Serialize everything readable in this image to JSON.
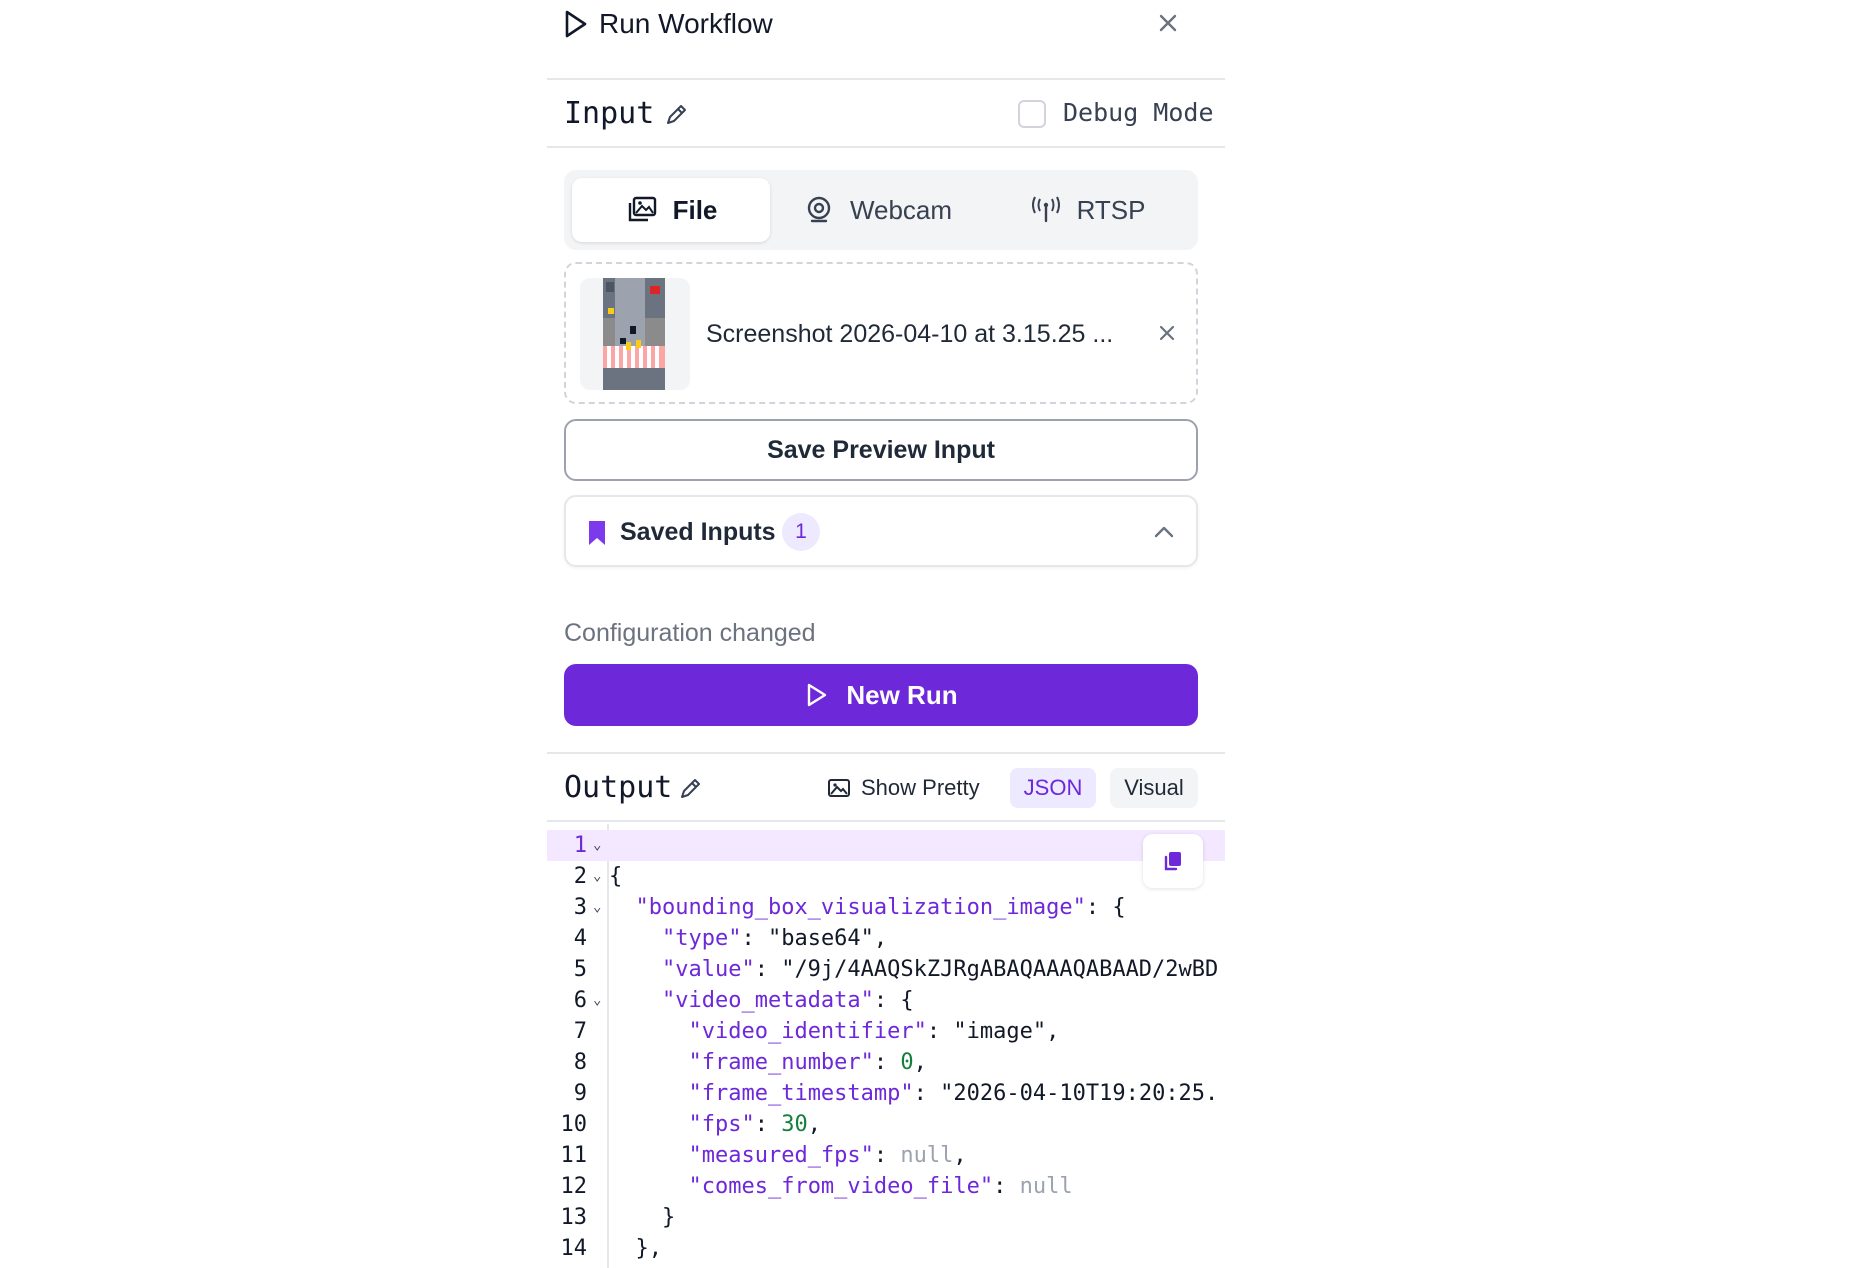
{
  "header": {
    "title": "Run Workflow"
  },
  "input": {
    "title": "Input",
    "debug_label": "Debug Mode"
  },
  "tabs": [
    {
      "label": "File",
      "icon": "image-stack-icon"
    },
    {
      "label": "Webcam",
      "icon": "webcam-icon"
    },
    {
      "label": "RTSP",
      "icon": "antenna-icon"
    }
  ],
  "file": {
    "name": "Screenshot 2026-04-10 at 3.15.25 ..."
  },
  "save_preview_label": "Save Preview Input",
  "saved_inputs": {
    "label": "Saved Inputs",
    "count": "1"
  },
  "config_changed": "Configuration changed",
  "new_run_label": "New Run",
  "output": {
    "title": "Output",
    "show_pretty": "Show Pretty",
    "json_label": "JSON",
    "visual_label": "Visual"
  },
  "code": {
    "line_numbers": [
      "1",
      "2",
      "3",
      "4",
      "5",
      "6",
      "7",
      "8",
      "9",
      "10",
      "11",
      "12",
      "13",
      "14"
    ],
    "lines": [
      "",
      "{",
      "  \"bounding_box_visualization_image\": {",
      "    \"type\": \"base64\",",
      "    \"value\": \"/9j/4AAQSkZJRgABAQAAAQABAAD/2wBD",
      "    \"video_metadata\": {",
      "      \"video_identifier\": \"image\",",
      "      \"frame_number\": 0,",
      "      \"frame_timestamp\": \"2026-04-10T19:20:25.",
      "      \"fps\": 30,",
      "      \"measured_fps\": null,",
      "      \"comes_from_video_file\": null",
      "    }",
      "  },"
    ]
  },
  "colors": {
    "accent": "#6d28d9",
    "accent_light": "#ede9fe",
    "highlight_line": "#f3e8ff"
  }
}
